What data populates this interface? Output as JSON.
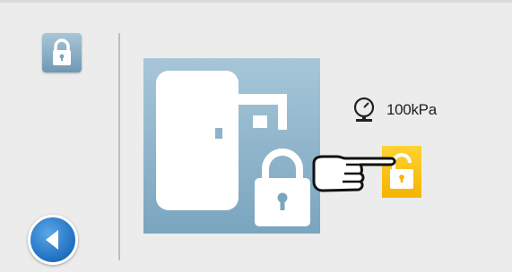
{
  "pressure": {
    "value_label": "100kPa"
  },
  "icons": {
    "sidebar_lock": "lock-closed-icon",
    "back": "left-arrow-icon",
    "door_lock_illustration": "door-lock-illustration",
    "pressure_gauge": "pressure-gauge-icon",
    "unlock": "lock-open-icon",
    "pointer": "pointing-hand-icon"
  },
  "colors": {
    "accent_blue": "#1f6fc0",
    "tile_blue": "#7aa5bf",
    "unlock_yellow": "#f5b400",
    "background": "#ececec"
  }
}
